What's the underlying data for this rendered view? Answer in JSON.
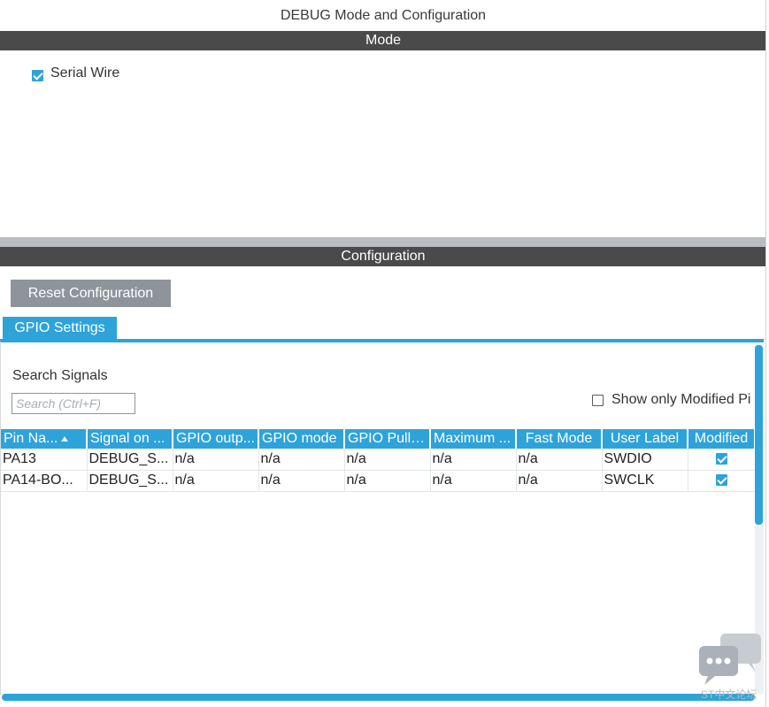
{
  "window": {
    "title": "DEBUG Mode and Configuration"
  },
  "mode_section": {
    "header": "Mode",
    "serial_wire": {
      "label": "Serial Wire",
      "checked": true
    }
  },
  "config_section": {
    "header": "Configuration",
    "reset_button": "Reset Configuration",
    "tabs": [
      {
        "label": "GPIO Settings",
        "active": true
      }
    ],
    "search": {
      "label": "Search Signals",
      "placeholder": "Search (Ctrl+F)",
      "value": ""
    },
    "show_only_modified": {
      "label": "Show only Modified Pi",
      "checked": false
    },
    "table": {
      "columns": [
        "Pin Na...",
        "Signal on ...",
        "GPIO outp...",
        "GPIO mode",
        "GPIO Pull-...",
        "Maximum ...",
        "Fast Mode",
        "User Label",
        "Modified"
      ],
      "rows": [
        {
          "pin": "PA13",
          "signal": "DEBUG_S...",
          "gpio_output": "n/a",
          "gpio_mode": "n/a",
          "gpio_pull": "n/a",
          "maximum": "n/a",
          "fast_mode": "n/a",
          "user_label": "SWDIO",
          "modified": true
        },
        {
          "pin": "PA14-BO...",
          "signal": "DEBUG_S...",
          "gpio_output": "n/a",
          "gpio_mode": "n/a",
          "gpio_pull": "n/a",
          "maximum": "n/a",
          "fast_mode": "n/a",
          "user_label": "SWCLK",
          "modified": true
        }
      ]
    }
  },
  "watermark": {
    "text": "ST中文论坛"
  },
  "colors": {
    "accent": "#2ea3d9",
    "section_bar": "#4a4a4a",
    "button_gray": "#8e949a"
  }
}
